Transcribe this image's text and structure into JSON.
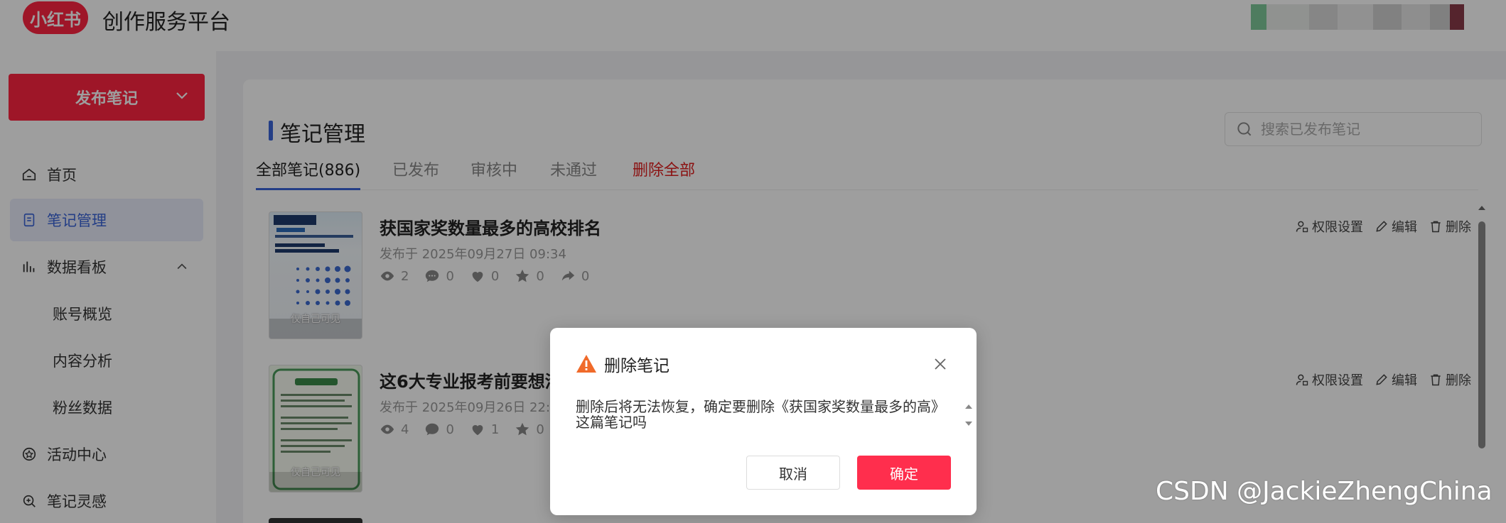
{
  "header": {
    "logo_text": "小红书",
    "app_title": "创作服务平台",
    "brand_color": "#ff2442"
  },
  "sidebar": {
    "publish_label": "发布笔记",
    "items": [
      {
        "label": "首页",
        "icon": "home-icon"
      },
      {
        "label": "笔记管理",
        "icon": "document-icon",
        "active": true
      },
      {
        "label": "数据看板",
        "icon": "bar-chart-icon",
        "expanded": true
      },
      {
        "label": "账号概览"
      },
      {
        "label": "内容分析"
      },
      {
        "label": "粉丝数据"
      },
      {
        "label": "活动中心",
        "icon": "activity-icon"
      },
      {
        "label": "笔记灵感",
        "icon": "inspiration-icon"
      }
    ]
  },
  "main": {
    "title": "笔记管理",
    "search_placeholder": "搜索已发布笔记",
    "tabs": [
      {
        "label": "全部笔记(886)",
        "active": true
      },
      {
        "label": "已发布"
      },
      {
        "label": "审核中"
      },
      {
        "label": "未通过"
      },
      {
        "label": "删除全部",
        "danger": true
      }
    ],
    "notes": [
      {
        "title": "获国家奖数量最多的高校排名",
        "time": "发布于 2025年09月27日 09:34",
        "visibility": "仅自己可见",
        "stats": {
          "views": "2",
          "comments": "0",
          "likes": "0",
          "collects": "0",
          "shares": "0"
        },
        "actions": {
          "permission": "权限设置",
          "edit": "编辑",
          "delete": "删除"
        }
      },
      {
        "title": "这6大专业报考前要想清",
        "time": "发布于 2025年09月26日 22:58",
        "visibility": "仅自己可见",
        "stats": {
          "views": "4",
          "comments": "0",
          "likes": "1",
          "collects": "0"
        },
        "actions": {
          "permission": "权限设置",
          "edit": "编辑",
          "delete": "删除"
        }
      }
    ]
  },
  "modal": {
    "title": "删除笔记",
    "body": "删除后将无法恢复，确定要删除《获国家奖数量最多的高》这篇笔记吗",
    "cancel_label": "取消",
    "confirm_label": "确定",
    "warning_color": "#f06a2a",
    "confirm_color": "#ff2e4d"
  },
  "watermark": "CSDN @JackieZhengChina"
}
